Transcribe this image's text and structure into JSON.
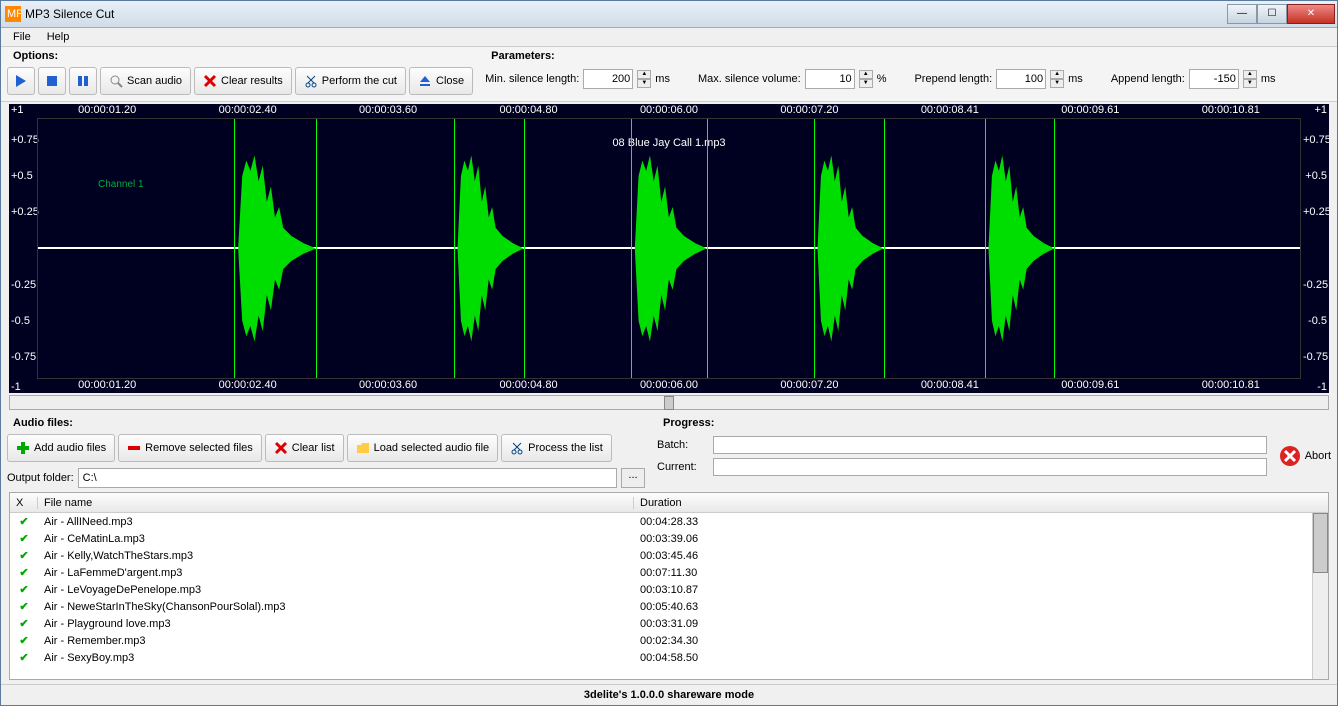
{
  "window": {
    "title": "MP3 Silence Cut"
  },
  "menubar": {
    "file": "File",
    "help": "Help"
  },
  "options": {
    "label": "Options:",
    "scan_audio": "Scan audio",
    "clear_results": "Clear results",
    "perform_cut": "Perform the cut",
    "close": "Close"
  },
  "parameters": {
    "label": "Parameters:",
    "min_silence_label": "Min. silence length:",
    "min_silence_value": "200",
    "min_silence_unit": "ms",
    "max_vol_label": "Max. silence volume:",
    "max_vol_value": "10",
    "max_vol_unit": "%",
    "prepend_label": "Prepend length:",
    "prepend_value": "100",
    "prepend_unit": "ms",
    "append_label": "Append length:",
    "append_value": "-150",
    "append_unit": "ms"
  },
  "waveform": {
    "filename": "08 Blue Jay Call 1.mp3",
    "channel_label": "Channel 1",
    "amp_ticks": [
      "+1",
      "+0.75",
      "+0.5",
      "+0.25",
      "-0.25",
      "-0.5",
      "-0.75",
      "-1"
    ],
    "amp_ticks_r": [
      "+1",
      "+0.75",
      "+0.5",
      "+0.25",
      "-0.25",
      "-0.5",
      "-0.75",
      "-1"
    ],
    "time_ticks": [
      "00:00:01.20",
      "00:00:02.40",
      "00:00:03.60",
      "00:00:04.80",
      "00:00:06.00",
      "00:00:07.20",
      "00:00:08.41",
      "00:00:09.61",
      "00:00:10.81"
    ]
  },
  "audio_files": {
    "label": "Audio files:",
    "add": "Add audio files",
    "remove": "Remove selected files",
    "clear": "Clear list",
    "load": "Load selected audio file",
    "process": "Process the list",
    "output_folder_label": "Output folder:",
    "output_folder_value": "C:\\"
  },
  "progress": {
    "label": "Progress:",
    "batch": "Batch:",
    "current": "Current:",
    "abort": "Abort"
  },
  "filelist": {
    "col_x": "X",
    "col_name": "File name",
    "col_dur": "Duration",
    "rows": [
      {
        "name": "Air - AllINeed.mp3",
        "dur": "00:04:28.33"
      },
      {
        "name": "Air - CeMatinLa.mp3",
        "dur": "00:03:39.06"
      },
      {
        "name": "Air - Kelly,WatchTheStars.mp3",
        "dur": "00:03:45.46"
      },
      {
        "name": "Air - LaFemmeD'argent.mp3",
        "dur": "00:07:11.30"
      },
      {
        "name": "Air - LeVoyageDePenelope.mp3",
        "dur": "00:03:10.87"
      },
      {
        "name": "Air - NeweStarInTheSky(ChansonPourSolal).mp3",
        "dur": "00:05:40.63"
      },
      {
        "name": "Air - Playground love.mp3",
        "dur": "00:03:31.09"
      },
      {
        "name": "Air - Remember.mp3",
        "dur": "00:02:34.30"
      },
      {
        "name": "Air - SexyBoy.mp3",
        "dur": "00:04:58.50"
      }
    ]
  },
  "statusbar": {
    "text": "3delite's  1.0.0.0 shareware mode"
  }
}
